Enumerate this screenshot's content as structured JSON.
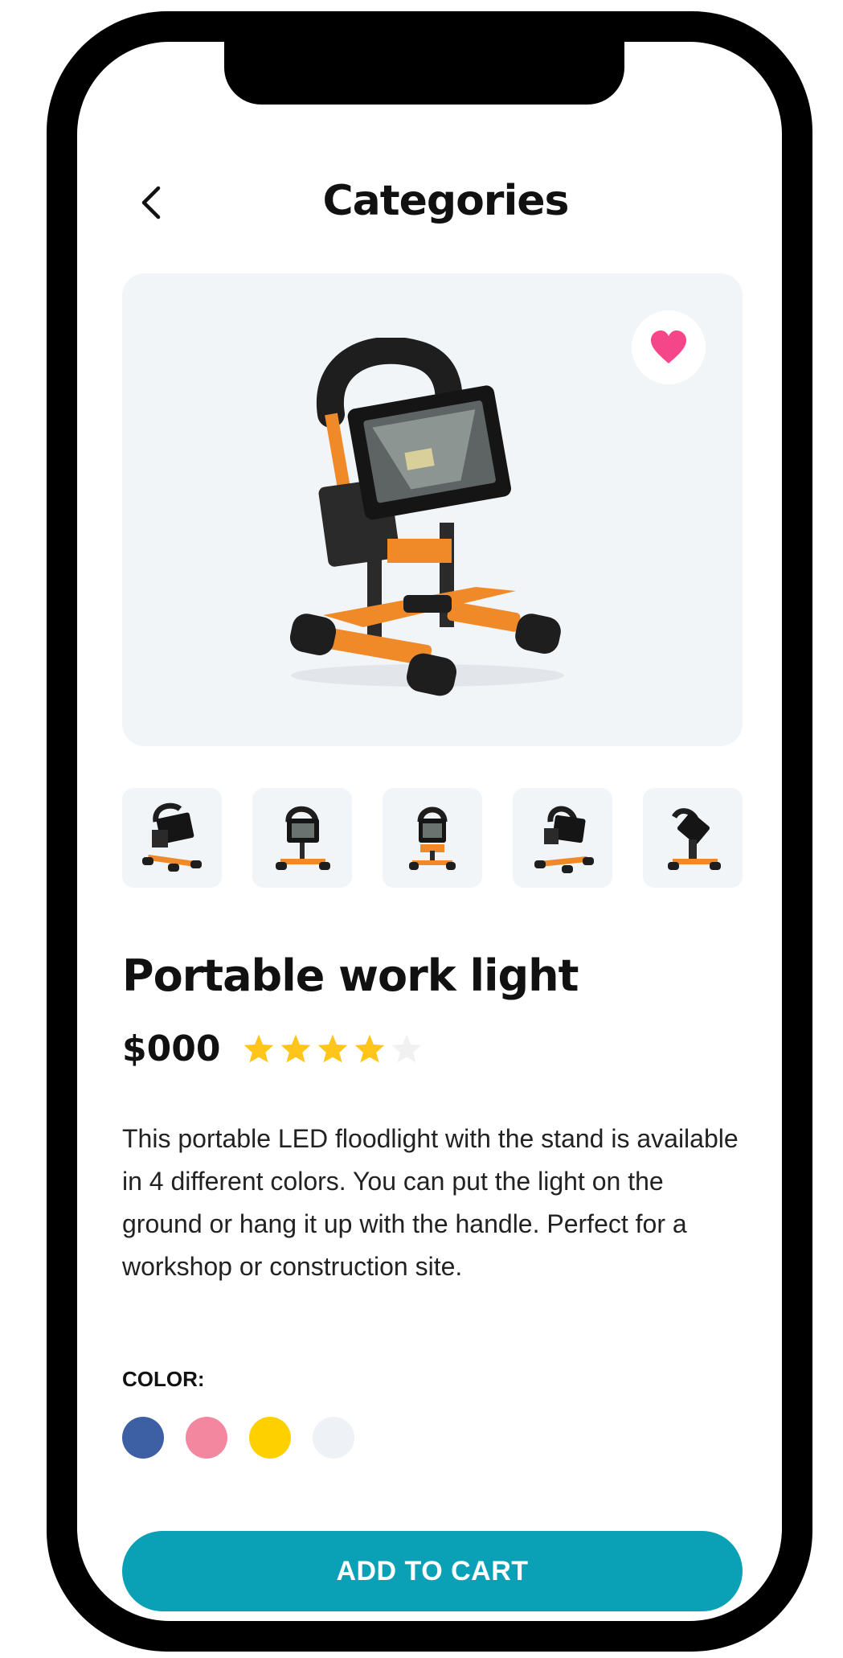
{
  "header": {
    "title": "Categories",
    "back_icon": "chevron-left-icon"
  },
  "product": {
    "name": "Portable work light",
    "price": "$000",
    "rating": 4,
    "rating_max": 5,
    "description": "This portable LED floodlight with the stand is available in 4 different colors. You can put the light on the ground or hang it up with the handle. Perfect for a workshop or construction site.",
    "favorite": true,
    "image_count": 5
  },
  "colors": {
    "label": "COLOR:",
    "options": [
      "#3d5fa3",
      "#f3879f",
      "#ffd000",
      "#eef1f5"
    ]
  },
  "actions": {
    "add_to_cart": "ADD TO CART"
  },
  "theme": {
    "accent": "#0aa0b5",
    "heart": "#f5468a",
    "star_filled": "#ffc51a",
    "star_empty": "#f1f1f1"
  }
}
